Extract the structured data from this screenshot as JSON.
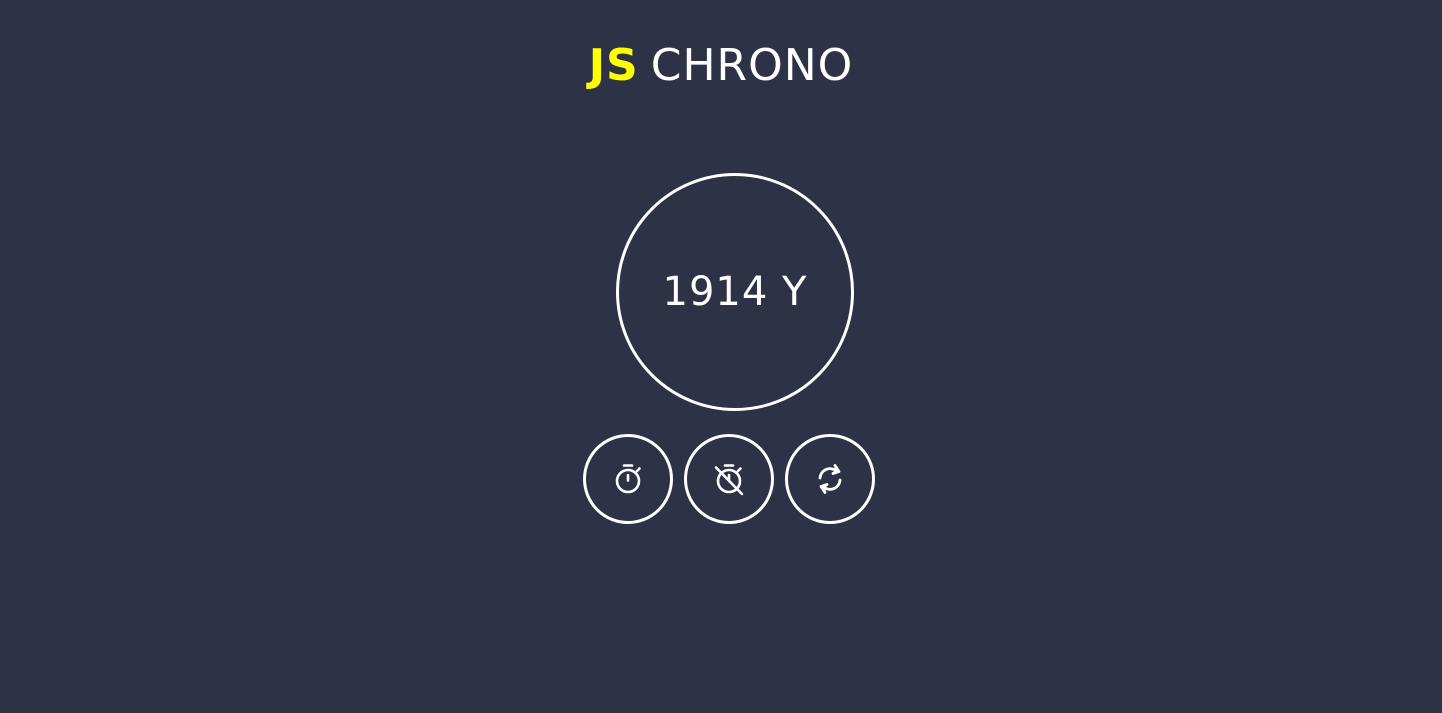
{
  "header": {
    "accent": "JS",
    "title": "CHRONO"
  },
  "display": {
    "value": "1914 Y"
  },
  "controls": [
    {
      "name": "start-button",
      "icon": "stopwatch-icon"
    },
    {
      "name": "stop-button",
      "icon": "stopwatch-off-icon"
    },
    {
      "name": "reset-button",
      "icon": "refresh-icon"
    }
  ],
  "colors": {
    "background": "#2d3246",
    "accent": "#ffff00",
    "foreground": "#ffffff"
  }
}
